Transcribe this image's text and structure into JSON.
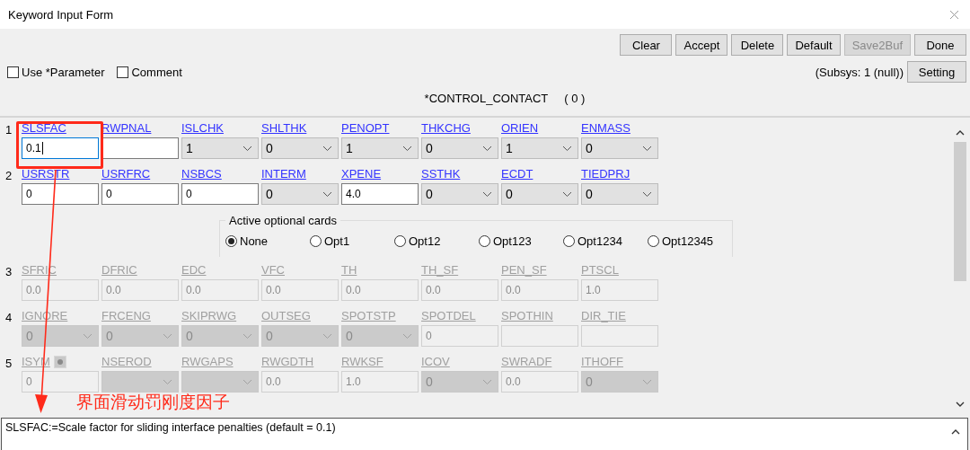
{
  "window": {
    "title": "Keyword Input Form"
  },
  "buttons": [
    {
      "label": "Clear",
      "disabled": false
    },
    {
      "label": "Accept",
      "disabled": false
    },
    {
      "label": "Delete",
      "disabled": false
    },
    {
      "label": "Default",
      "disabled": false
    },
    {
      "label": "Save2Buf",
      "disabled": true
    },
    {
      "label": "Done",
      "disabled": false
    }
  ],
  "options": [
    {
      "label": "Use *Parameter",
      "checked": false
    },
    {
      "label": "Comment",
      "checked": false
    }
  ],
  "subsys": "(Subsys: 1 (null))",
  "setting_button": "Setting",
  "keyword_title": "*CONTROL_CONTACT",
  "keyword_count": "( 0 )",
  "cards": [
    {
      "number": "1",
      "fields": [
        {
          "label": "SLSFAC",
          "kind": "text",
          "value": "0.1",
          "disabled": false,
          "focused": true
        },
        {
          "label": "RWPNAL",
          "kind": "text",
          "disabled": false,
          "focused": false
        },
        {
          "label": "ISLCHK",
          "kind": "select",
          "value": "1",
          "disabled": false,
          "focused": false
        },
        {
          "label": "SHLTHK",
          "kind": "select",
          "value": "0",
          "disabled": false,
          "focused": false
        },
        {
          "label": "PENOPT",
          "kind": "select",
          "value": "1",
          "disabled": false,
          "focused": false
        },
        {
          "label": "THKCHG",
          "kind": "select",
          "value": "0",
          "disabled": false,
          "focused": false
        },
        {
          "label": "ORIEN",
          "kind": "select",
          "value": "1",
          "disabled": false,
          "focused": false
        },
        {
          "label": "ENMASS",
          "kind": "select",
          "value": "0",
          "disabled": false,
          "focused": false
        }
      ]
    },
    {
      "number": "2",
      "fields": [
        {
          "label": "USRSTR",
          "kind": "text",
          "value": "0",
          "disabled": false,
          "focused": false
        },
        {
          "label": "USRFRC",
          "kind": "text",
          "value": "0",
          "disabled": false,
          "focused": false
        },
        {
          "label": "NSBCS",
          "kind": "text",
          "value": "0",
          "disabled": false,
          "focused": false
        },
        {
          "label": "INTERM",
          "kind": "select",
          "value": "0",
          "disabled": false,
          "focused": false
        },
        {
          "label": "XPENE",
          "kind": "text",
          "value": "4.0",
          "disabled": false,
          "focused": false
        },
        {
          "label": "SSTHK",
          "kind": "select",
          "value": "0",
          "disabled": false,
          "focused": false
        },
        {
          "label": "ECDT",
          "kind": "select",
          "value": "0",
          "disabled": false,
          "focused": false
        },
        {
          "label": "TIEDPRJ",
          "kind": "select",
          "value": "0",
          "disabled": false,
          "focused": false
        }
      ]
    },
    {
      "number": "3",
      "fields": [
        {
          "label": "SFRIC",
          "kind": "text",
          "value": "0.0",
          "disabled": true,
          "focused": false
        },
        {
          "label": "DFRIC",
          "kind": "text",
          "value": "0.0",
          "disabled": true,
          "focused": false
        },
        {
          "label": "EDC",
          "kind": "text",
          "value": "0.0",
          "disabled": true,
          "focused": false
        },
        {
          "label": "VFC",
          "kind": "text",
          "value": "0.0",
          "disabled": true,
          "focused": false
        },
        {
          "label": "TH",
          "kind": "text",
          "value": "0.0",
          "disabled": true,
          "focused": false
        },
        {
          "label": "TH_SF",
          "kind": "text",
          "value": "0.0",
          "disabled": true,
          "focused": false
        },
        {
          "label": "PEN_SF",
          "kind": "text",
          "value": "0.0",
          "disabled": true,
          "focused": false
        },
        {
          "label": "PTSCL",
          "kind": "text",
          "value": "1.0",
          "disabled": true,
          "focused": false
        }
      ]
    },
    {
      "number": "4",
      "fields": [
        {
          "label": "IGNORE",
          "kind": "select",
          "value": "0",
          "disabled": true,
          "focused": false
        },
        {
          "label": "FRCENG",
          "kind": "select",
          "value": "0",
          "disabled": true,
          "focused": false
        },
        {
          "label": "SKIPRWG",
          "kind": "select",
          "value": "0",
          "disabled": true,
          "focused": false
        },
        {
          "label": "OUTSEG",
          "kind": "select",
          "value": "0",
          "disabled": true,
          "focused": false
        },
        {
          "label": "SPOTSTP",
          "kind": "select",
          "value": "0",
          "disabled": true,
          "focused": false
        },
        {
          "label": "SPOTDEL",
          "kind": "text",
          "value": "0",
          "disabled": true,
          "focused": false
        },
        {
          "label": "SPOTHIN",
          "kind": "text",
          "disabled": true,
          "focused": false
        },
        {
          "label": "DIR_TIE",
          "kind": "text",
          "disabled": true,
          "focused": false
        }
      ]
    },
    {
      "number": "5",
      "fields": [
        {
          "label": "ISYM",
          "kind": "text",
          "value": "0",
          "disabled": true,
          "focused": false,
          "toggle": true
        },
        {
          "label": "NSEROD",
          "kind": "select",
          "disabled": true,
          "focused": false
        },
        {
          "label": "RWGAPS",
          "kind": "select",
          "disabled": true,
          "focused": false
        },
        {
          "label": "RWGDTH",
          "kind": "text",
          "value": "0.0",
          "disabled": true,
          "focused": false
        },
        {
          "label": "RWKSF",
          "kind": "text",
          "value": "1.0",
          "disabled": true,
          "focused": false
        },
        {
          "label": "ICOV",
          "kind": "select",
          "value": "0",
          "disabled": true,
          "focused": false
        },
        {
          "label": "SWRADF",
          "kind": "text",
          "value": "0.0",
          "disabled": true,
          "focused": false
        },
        {
          "label": "ITHOFF",
          "kind": "select",
          "value": "0",
          "disabled": true,
          "focused": false
        }
      ]
    }
  ],
  "optional_cards": {
    "title": "Active optional cards",
    "choices": [
      {
        "label": "None",
        "selected": true
      },
      {
        "label": "Opt1",
        "selected": false
      },
      {
        "label": "Opt12",
        "selected": false
      },
      {
        "label": "Opt123",
        "selected": false
      },
      {
        "label": "Opt1234",
        "selected": false
      },
      {
        "label": "Opt12345",
        "selected": false
      }
    ]
  },
  "annotation": {
    "text": "界面滑动罚刚度因子"
  },
  "help_text": "SLSFAC:=Scale factor for sliding interface penalties (default = 0.1)"
}
